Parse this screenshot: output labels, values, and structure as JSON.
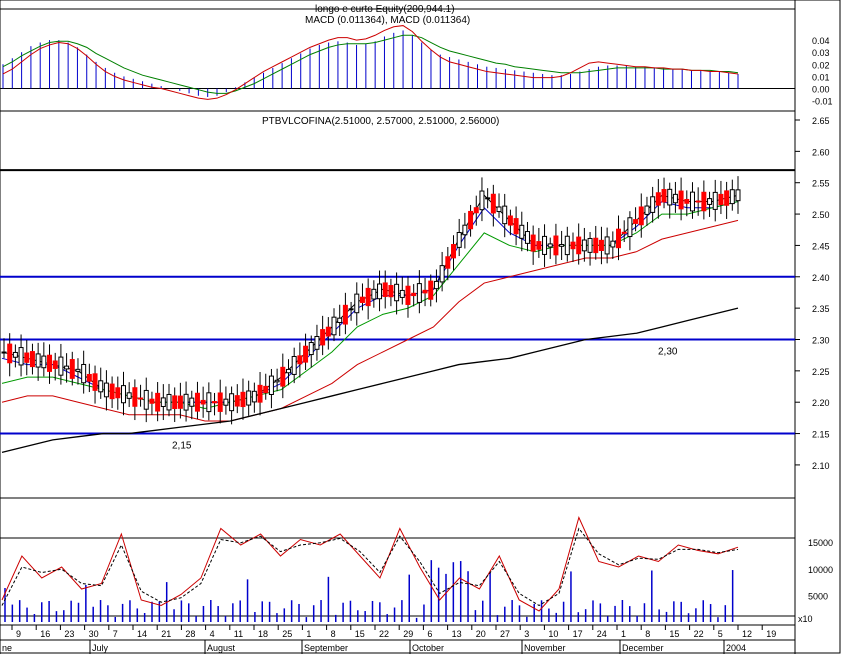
{
  "chart_data": [
    {
      "type": "bar",
      "panel": "macd",
      "title": "longo e curto Equity(200,944.1)",
      "subtitle": "MACD (0.011364), MACD (0.011364)",
      "ylim": [
        -0.012,
        0.05
      ],
      "ticks": [
        "0.04",
        "0.03",
        "0.02",
        "0.01",
        "0.00",
        "-0.01"
      ],
      "tick_values": [
        0.04,
        0.03,
        0.02,
        0.01,
        0.0,
        -0.01
      ],
      "series": [
        {
          "values": [
            0.02,
            0.025,
            0.03,
            0.035,
            0.038,
            0.04,
            0.04,
            0.038,
            0.034,
            0.028,
            0.022,
            0.017,
            0.013,
            0.01,
            0.008,
            0.006,
            0.004,
            0.002,
            0.0,
            -0.002,
            -0.004,
            -0.006,
            -0.007,
            -0.006,
            -0.003,
            0.001,
            0.005,
            0.009,
            0.013,
            0.017,
            0.021,
            0.025,
            0.029,
            0.033,
            0.036,
            0.038,
            0.039,
            0.038,
            0.036,
            0.037,
            0.039,
            0.043,
            0.046,
            0.048,
            0.044,
            0.038,
            0.032,
            0.028,
            0.026,
            0.024,
            0.022,
            0.02,
            0.018,
            0.017,
            0.016,
            0.015,
            0.014,
            0.013,
            0.012,
            0.011,
            0.011,
            0.012,
            0.014,
            0.016,
            0.018,
            0.019,
            0.019,
            0.019,
            0.018,
            0.018,
            0.017,
            0.017,
            0.016,
            0.016,
            0.015,
            0.015,
            0.014,
            0.014,
            0.013,
            0.012
          ]
        },
        {
          "color": "#008000",
          "values": [
            0.018,
            0.022,
            0.027,
            0.031,
            0.035,
            0.038,
            0.039,
            0.039,
            0.037,
            0.034,
            0.029,
            0.025,
            0.021,
            0.017,
            0.014,
            0.011,
            0.009,
            0.007,
            0.005,
            0.003,
            0.001,
            -0.001,
            -0.003,
            -0.004,
            -0.004,
            -0.002,
            0.001,
            0.004,
            0.008,
            0.012,
            0.016,
            0.02,
            0.024,
            0.028,
            0.031,
            0.034,
            0.036,
            0.037,
            0.037,
            0.037,
            0.038,
            0.04,
            0.042,
            0.044,
            0.044,
            0.042,
            0.038,
            0.034,
            0.031,
            0.029,
            0.027,
            0.025,
            0.023,
            0.021,
            0.02,
            0.018,
            0.017,
            0.016,
            0.015,
            0.014,
            0.013,
            0.013,
            0.013,
            0.014,
            0.015,
            0.016,
            0.017,
            0.017,
            0.017,
            0.017,
            0.017,
            0.016,
            0.016,
            0.016,
            0.015,
            0.015,
            0.015,
            0.014,
            0.014,
            0.013
          ]
        },
        {
          "color": "#cc0000",
          "values": [
            0.012,
            0.016,
            0.022,
            0.028,
            0.033,
            0.036,
            0.038,
            0.037,
            0.033,
            0.027,
            0.02,
            0.014,
            0.01,
            0.007,
            0.005,
            0.003,
            0.001,
            0.0,
            -0.002,
            -0.004,
            -0.006,
            -0.008,
            -0.009,
            -0.008,
            -0.005,
            -0.001,
            0.004,
            0.009,
            0.014,
            0.018,
            0.022,
            0.026,
            0.03,
            0.034,
            0.037,
            0.04,
            0.042,
            0.042,
            0.04,
            0.041,
            0.044,
            0.048,
            0.051,
            0.052,
            0.047,
            0.039,
            0.032,
            0.026,
            0.022,
            0.02,
            0.018,
            0.016,
            0.014,
            0.013,
            0.012,
            0.011,
            0.01,
            0.009,
            0.009,
            0.009,
            0.01,
            0.013,
            0.017,
            0.021,
            0.022,
            0.021,
            0.02,
            0.019,
            0.018,
            0.018,
            0.017,
            0.017,
            0.016,
            0.016,
            0.015,
            0.015,
            0.014,
            0.014,
            0.013,
            0.012
          ]
        }
      ]
    },
    {
      "type": "candlestick",
      "panel": "price",
      "title": "PTBVLCOFINA(2.51000, 2.57000, 2.51000, 2.56000)",
      "ylim": [
        2.06,
        2.65
      ],
      "ticks": [
        "2.65",
        "2.60",
        "2.55",
        "2.50",
        "2.45",
        "2.40",
        "2.35",
        "2.30",
        "2.25",
        "2.20",
        "2.15",
        "2.10"
      ],
      "tick_values": [
        2.65,
        2.6,
        2.55,
        2.5,
        2.45,
        2.4,
        2.35,
        2.3,
        2.25,
        2.2,
        2.15,
        2.1
      ],
      "x_labels": [
        "9",
        "16",
        "23",
        "30",
        "7",
        "14",
        "21",
        "28",
        "4",
        "11",
        "18",
        "25",
        "1",
        "8",
        "15",
        "22",
        "29",
        "6",
        "13",
        "20",
        "27",
        "3",
        "10",
        "17",
        "24",
        "1",
        "8",
        "15",
        "22",
        "5",
        "12",
        "19"
      ],
      "month_labels": [
        "ne",
        "July",
        "August",
        "September",
        "October",
        "November",
        "December",
        "2004"
      ],
      "series": [
        {
          "color": "#000000",
          "values": [
            2.28,
            2.27,
            2.26,
            2.25,
            2.22,
            2.21,
            2.2,
            2.2,
            2.2,
            2.2,
            2.21,
            2.24,
            2.28,
            2.32,
            2.36,
            2.38,
            2.37,
            2.38,
            2.46,
            2.53,
            2.49,
            2.45,
            2.45,
            2.45,
            2.45,
            2.49,
            2.53,
            2.52,
            2.52,
            2.53
          ]
        },
        {
          "color": "#0000cc",
          "values": [
            2.27,
            2.26,
            2.26,
            2.24,
            2.22,
            2.21,
            2.2,
            2.2,
            2.2,
            2.2,
            2.21,
            2.23,
            2.27,
            2.31,
            2.35,
            2.37,
            2.37,
            2.38,
            2.45,
            2.51,
            2.47,
            2.45,
            2.45,
            2.45,
            2.45,
            2.48,
            2.52,
            2.51,
            2.51,
            2.52
          ]
        },
        {
          "color": "#009900",
          "values": [
            2.23,
            2.24,
            2.24,
            2.23,
            2.22,
            2.21,
            2.2,
            2.2,
            2.19,
            2.2,
            2.21,
            2.22,
            2.25,
            2.28,
            2.32,
            2.34,
            2.35,
            2.37,
            2.42,
            2.47,
            2.45,
            2.44,
            2.45,
            2.45,
            2.45,
            2.47,
            2.5,
            2.5,
            2.51,
            2.52
          ]
        },
        {
          "color": "#cc0000",
          "values": [
            2.2,
            2.21,
            2.21,
            2.2,
            2.19,
            2.18,
            2.18,
            2.18,
            2.17,
            2.17,
            2.18,
            2.19,
            2.21,
            2.23,
            2.26,
            2.28,
            2.3,
            2.32,
            2.36,
            2.39,
            2.4,
            2.41,
            2.42,
            2.43,
            2.43,
            2.44,
            2.46,
            2.47,
            2.48,
            2.49
          ]
        },
        {
          "color": "#000000",
          "values": [
            2.12,
            2.13,
            2.14,
            2.145,
            2.15,
            2.15,
            2.155,
            2.16,
            2.165,
            2.17,
            2.18,
            2.19,
            2.2,
            2.21,
            2.22,
            2.23,
            2.24,
            2.25,
            2.26,
            2.265,
            2.27,
            2.28,
            2.29,
            2.3,
            2.305,
            2.31,
            2.32,
            2.33,
            2.34,
            2.35
          ]
        }
      ],
      "hlines": [
        {
          "value": 2.57,
          "color": "#000000",
          "label": ""
        },
        {
          "value": 2.4,
          "color": "#0000cc",
          "label": ""
        },
        {
          "value": 2.3,
          "color": "#0000cc",
          "label": "2,30"
        },
        {
          "value": 2.15,
          "color": "#0000cc",
          "label": "2,15"
        }
      ]
    },
    {
      "type": "line",
      "panel": "stochastic_volume",
      "ticks": [
        "15000",
        "10000",
        "5000"
      ],
      "tick_values": [
        15000,
        10000,
        5000
      ],
      "scale_note": "x10",
      "ylim": [
        0,
        22000
      ],
      "series": [
        {
          "color": "#cc0000",
          "values": [
            20,
            60,
            40,
            50,
            30,
            35,
            80,
            20,
            15,
            25,
            40,
            85,
            70,
            80,
            60,
            75,
            70,
            80,
            60,
            40,
            85,
            50,
            20,
            40,
            30,
            60,
            20,
            10,
            30,
            95,
            55,
            50,
            60,
            55,
            70,
            65,
            62,
            68
          ]
        },
        {
          "values": [
            15,
            50,
            45,
            48,
            35,
            33,
            70,
            28,
            18,
            22,
            35,
            75,
            72,
            78,
            64,
            70,
            72,
            76,
            64,
            45,
            78,
            55,
            26,
            36,
            33,
            55,
            26,
            15,
            26,
            85,
            62,
            52,
            58,
            57,
            66,
            66,
            63,
            66
          ]
        }
      ]
    }
  ]
}
